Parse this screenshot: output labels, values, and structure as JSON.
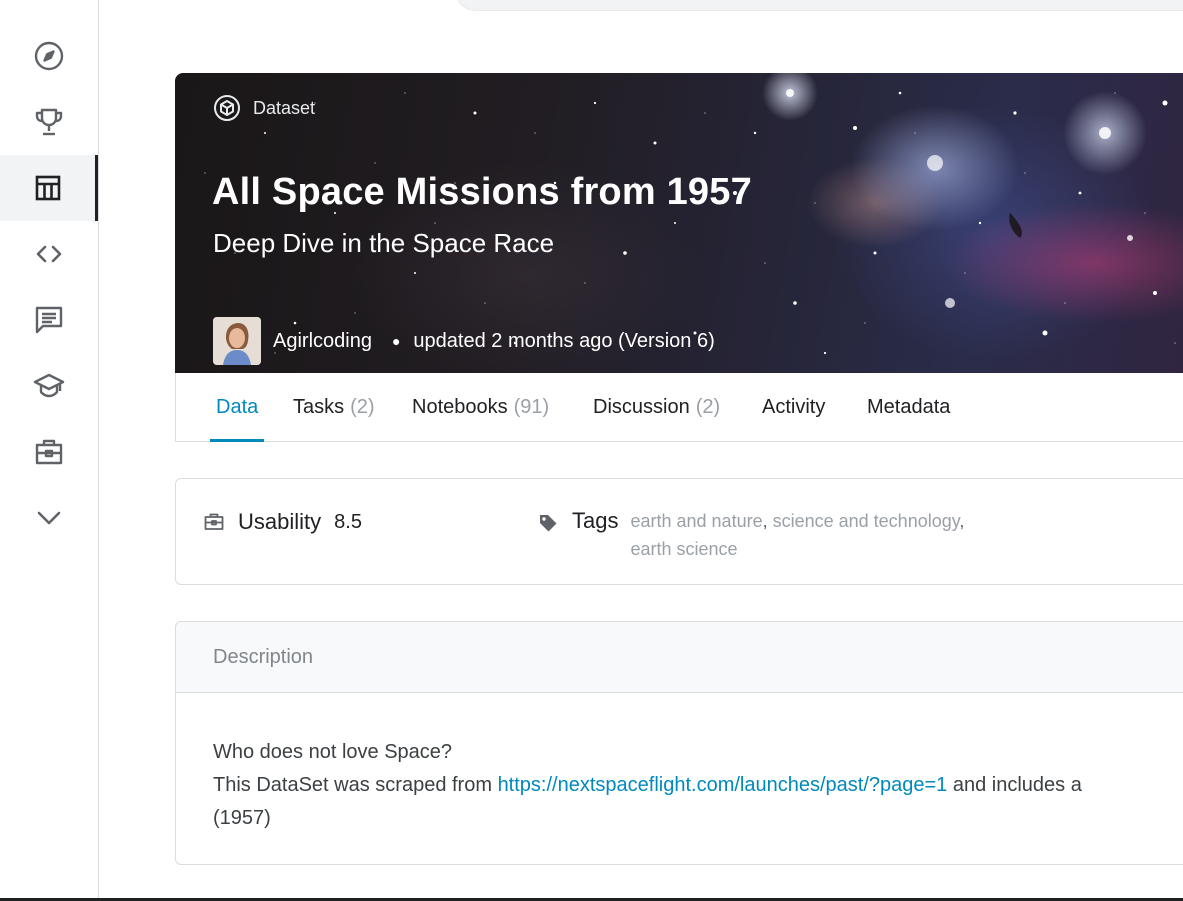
{
  "sidebar": {
    "items": [
      {
        "icon": "compass-icon",
        "name": "sidebar-item-explore",
        "active": false
      },
      {
        "icon": "trophy-icon",
        "name": "sidebar-item-competitions",
        "active": false
      },
      {
        "icon": "table-icon",
        "name": "sidebar-item-datasets",
        "active": true
      },
      {
        "icon": "code-icon",
        "name": "sidebar-item-code",
        "active": false
      },
      {
        "icon": "comment-icon",
        "name": "sidebar-item-discussions",
        "active": false
      },
      {
        "icon": "school-icon",
        "name": "sidebar-item-courses",
        "active": false
      },
      {
        "icon": "briefcase-icon",
        "name": "sidebar-item-jobs",
        "active": false
      },
      {
        "icon": "chevron-down-icon",
        "name": "sidebar-item-more",
        "active": false
      }
    ]
  },
  "banner": {
    "type_label": "Dataset",
    "title": "All Space Missions from 1957",
    "subtitle": "Deep Dive in the Space Race",
    "author": "Agirlcoding",
    "updated": "updated 2 months ago (Version 6)"
  },
  "tabs": [
    {
      "label": "Data",
      "count": "",
      "active": true
    },
    {
      "label": "Tasks",
      "count": "(2)",
      "active": false
    },
    {
      "label": "Notebooks",
      "count": "(91)",
      "active": false
    },
    {
      "label": "Discussion",
      "count": "(2)",
      "active": false
    },
    {
      "label": "Activity",
      "count": "",
      "active": false
    },
    {
      "label": "Metadata",
      "count": "",
      "active": false
    }
  ],
  "usability": {
    "label": "Usability",
    "value": "8.5"
  },
  "tags": {
    "label": "Tags",
    "items": [
      "earth and nature",
      "science and technology",
      "earth science"
    ]
  },
  "description": {
    "heading": "Description",
    "line1": "Who does not love Space?",
    "line2_prefix": "This DataSet was scraped from ",
    "link": "https://nextspaceflight.com/launches/past/?page=1",
    "line2_suffix": " and includes a",
    "line3": "(1957)"
  },
  "colors": {
    "accent": "#008abc",
    "muted": "#9aa0a6",
    "border": "#dadce0"
  }
}
